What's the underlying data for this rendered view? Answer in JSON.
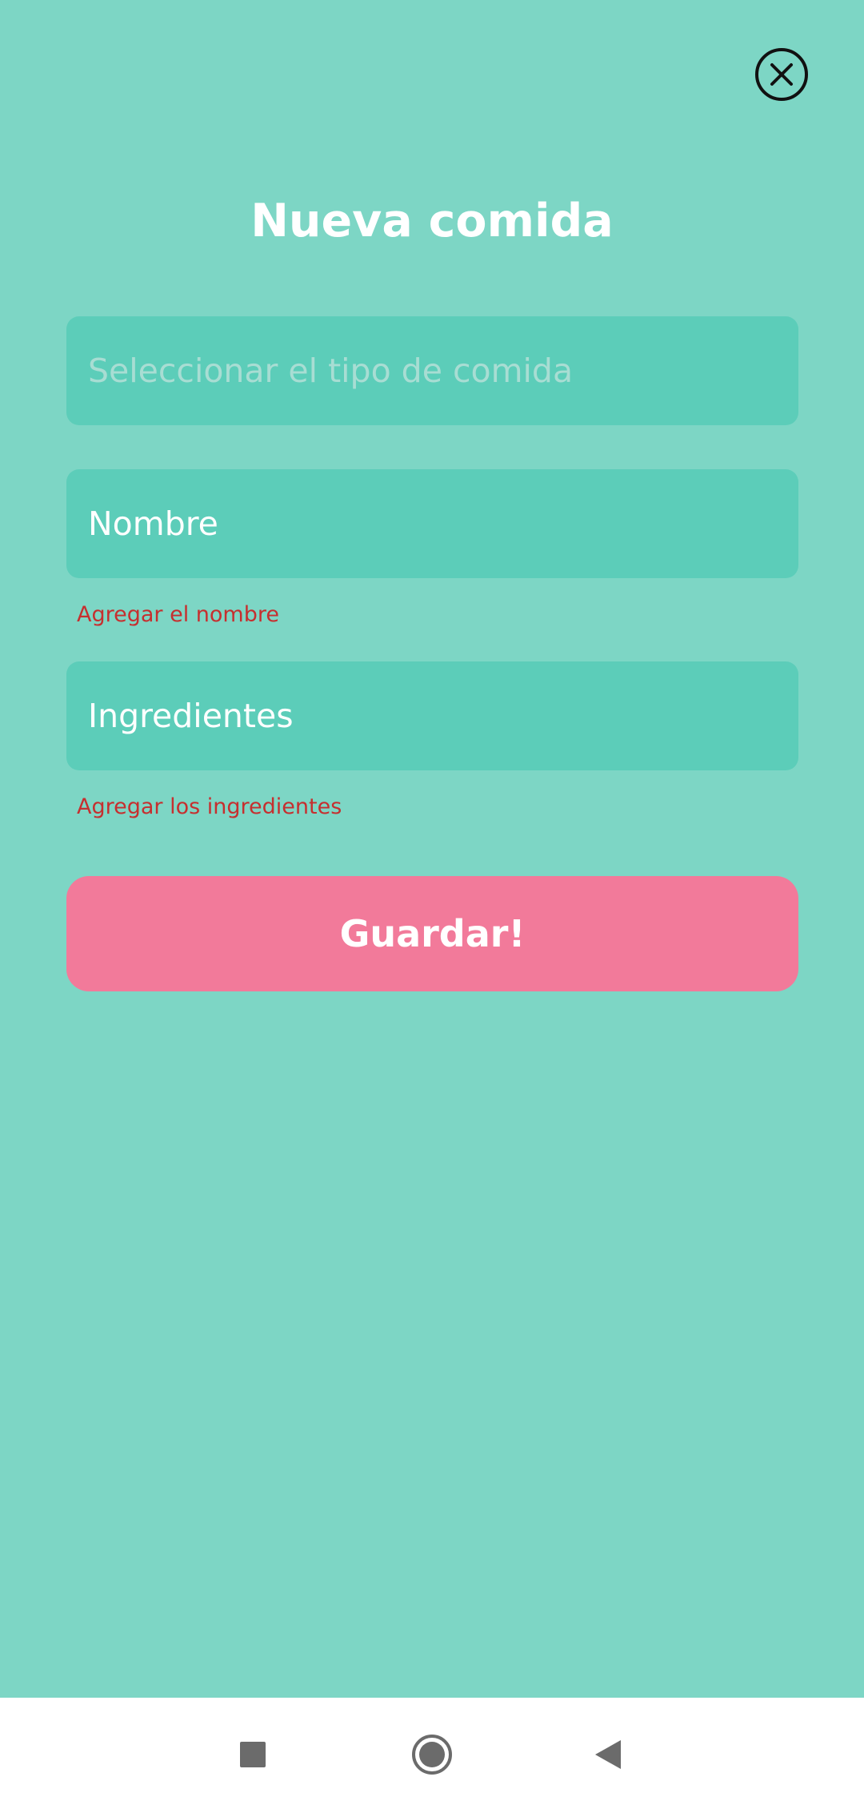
{
  "header": {
    "title": "Nueva comida",
    "close_icon": "close-circle-icon"
  },
  "form": {
    "meal_type": {
      "placeholder": "Seleccionar el tipo de comida",
      "value": ""
    },
    "name": {
      "value": "Nombre",
      "error": "Agregar el nombre"
    },
    "ingredients": {
      "value": "Ingredientes",
      "error": "Agregar los ingredientes"
    },
    "save_label": "Guardar!"
  },
  "navigation_bar": {
    "recents_icon": "square-icon",
    "home_icon": "circle-icon",
    "back_icon": "triangle-back-icon"
  },
  "colors": {
    "background": "#7dd6c5",
    "field": "#5ccdb9",
    "error": "#c62f2f",
    "button": "#f27a9a",
    "text": "#ffffff"
  }
}
